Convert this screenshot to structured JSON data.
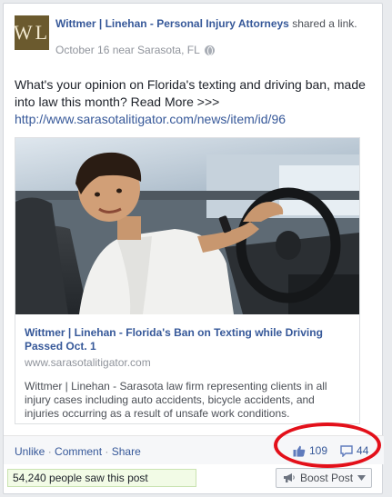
{
  "header": {
    "avatar_text": "WL",
    "page_name": "Wittmer | Linehan - Personal Injury Attorneys",
    "action_text": "shared a link.",
    "date": "October 16 near Sarasota, FL"
  },
  "message": {
    "text": "What's your opinion on Florida's texting and driving ban, made into law this month? Read More >>>",
    "link": "http://www.sarasotalitigator.com/news/item/id/96"
  },
  "card": {
    "image_icon": "teen-texting-while-driving-photo",
    "title": "Wittmer | Linehan - Florida's Ban on Texting while Driving Passed Oct. 1",
    "domain": "www.sarasotalitigator.com",
    "description": "Wittmer | Linehan - Sarasota law firm representing clients in all injury cases including auto accidents, bicycle accidents, and injuries occurring as a result of unsafe work conditions."
  },
  "actions": {
    "unlike": "Unlike",
    "comment": "Comment",
    "share": "Share",
    "separator": "·"
  },
  "counts": {
    "likes": "109",
    "comments": "44",
    "like_icon": "thumbs-up-icon",
    "comment_icon": "comment-bubble-icon",
    "highlight_color": "#e3101a"
  },
  "footer": {
    "seen": "54,240 people saw this post",
    "boost_label": "Boost Post",
    "boost_icon": "megaphone-icon"
  },
  "colors": {
    "link": "#365899",
    "meta": "#90949c",
    "background": "#e9ebee"
  }
}
